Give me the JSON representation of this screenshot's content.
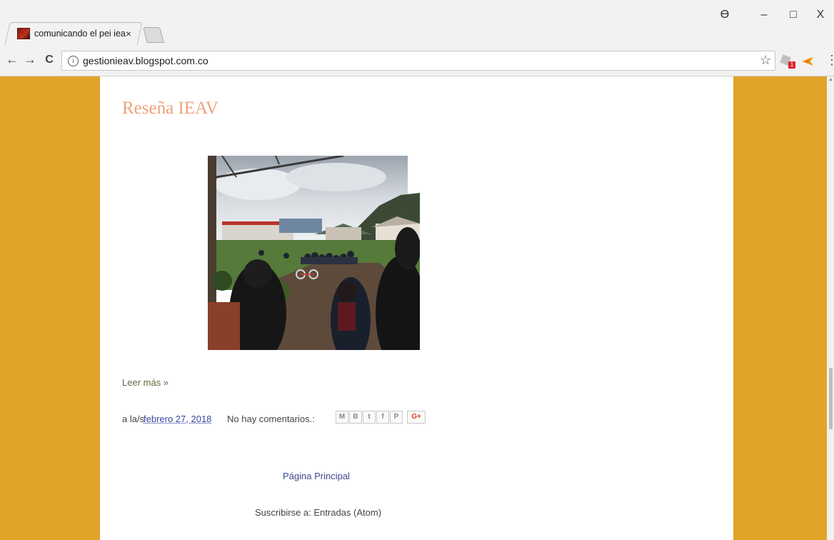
{
  "browser": {
    "tab_title": "comunicando el pei ieav",
    "tab_close": "×",
    "url": "gestionieav.blogspot.com.co",
    "back": "←",
    "forward": "→",
    "reload": "C",
    "info": "i",
    "star": "☆",
    "extension_badge": "1",
    "menu": "⋮",
    "window_controls": {
      "minimize": "–",
      "maximize": "□",
      "close": "X"
    },
    "profile": "ϴ"
  },
  "post": {
    "title": "Reseña IEAV",
    "read_more": "Leer más »",
    "posted_prefix": "a la/s",
    "date": "febrero 27, 2018",
    "comments": "No hay comentarios.:",
    "share_buttons": [
      "M",
      "B",
      "t",
      "f",
      "P",
      "G+"
    ]
  },
  "footer": {
    "home_link": "Página Principal",
    "subscribe_prefix": "Suscribirse a:",
    "subscribe_link": "Entradas (Atom)"
  },
  "colors": {
    "page_background": "#e1a428",
    "title_color": "#f0a07c",
    "link_color": "#3b46a0"
  }
}
